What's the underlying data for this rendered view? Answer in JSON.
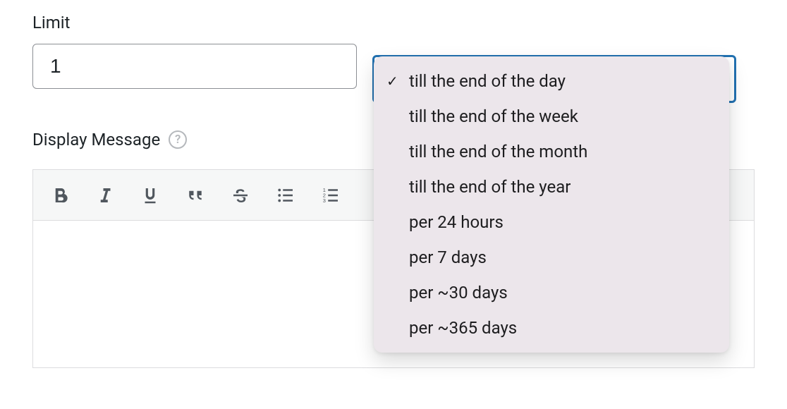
{
  "limit": {
    "label": "Limit",
    "value": "1"
  },
  "period_select": {
    "selected_index": 0,
    "options": [
      "till the end of the day",
      "till the end of the week",
      "till the end of the month",
      "till the end of the year",
      "per 24 hours",
      "per 7 days",
      "per ~30 days",
      "per ~365 days"
    ]
  },
  "message": {
    "label": "Display Message",
    "help_glyph": "?",
    "content": ""
  },
  "toolbar": {
    "buttons": [
      "bold",
      "italic",
      "underline",
      "blockquote",
      "strikethrough",
      "unordered-list",
      "ordered-list"
    ]
  }
}
